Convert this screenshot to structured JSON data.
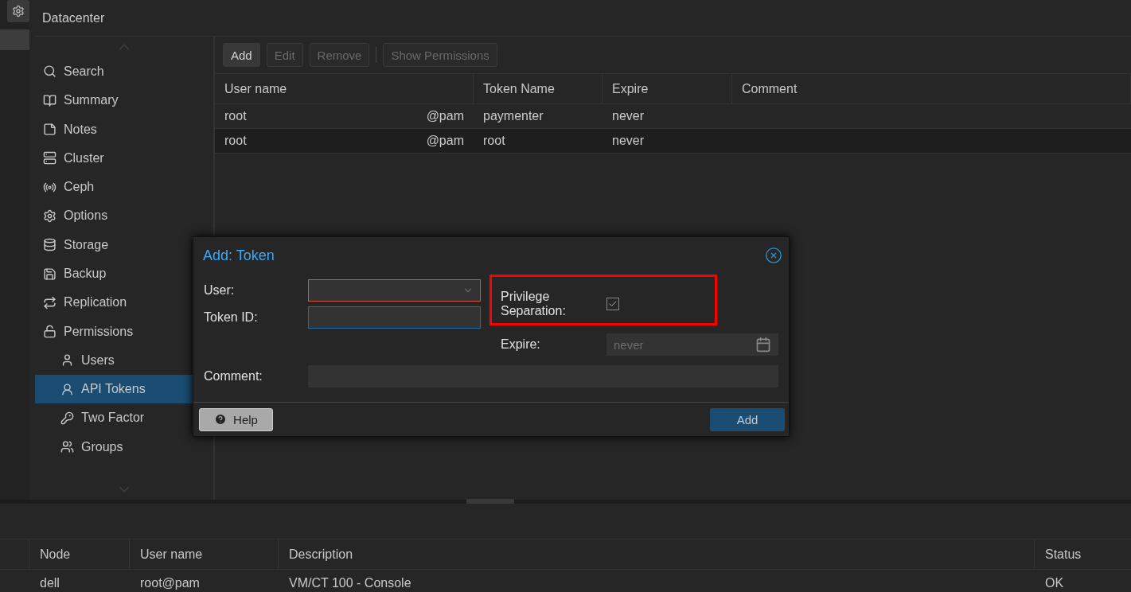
{
  "header": {
    "title": "Datacenter"
  },
  "nav": [
    {
      "label": "Search",
      "selected": false
    },
    {
      "label": "Summary",
      "selected": false
    },
    {
      "label": "Notes",
      "selected": false
    },
    {
      "label": "Cluster",
      "selected": false
    },
    {
      "label": "Ceph",
      "selected": false
    },
    {
      "label": "Options",
      "selected": false
    },
    {
      "label": "Storage",
      "selected": false
    },
    {
      "label": "Backup",
      "selected": false
    },
    {
      "label": "Replication",
      "selected": false
    },
    {
      "label": "Permissions",
      "selected": false,
      "children": [
        {
          "label": "Users",
          "selected": false
        },
        {
          "label": "API Tokens",
          "selected": true
        },
        {
          "label": "Two Factor",
          "selected": false
        },
        {
          "label": "Groups",
          "selected": false
        }
      ]
    }
  ],
  "toolbar": [
    {
      "label": "Add",
      "disabled": false
    },
    {
      "label": "Edit",
      "disabled": true
    },
    {
      "label": "Remove",
      "disabled": true
    },
    {
      "label": "Show Permissions",
      "disabled": true
    }
  ],
  "table": {
    "columns": [
      "User name",
      "Token Name",
      "Expire",
      "Comment"
    ],
    "rows": [
      {
        "user": "root",
        "realm": "@pam",
        "token": "paymenter",
        "expire": "never"
      },
      {
        "user": "root",
        "realm": "@pam",
        "token": "root",
        "expire": "never"
      }
    ]
  },
  "dialog": {
    "title": "Add: Token",
    "user": {
      "label": "User:",
      "invalid": true
    },
    "token_id": {
      "label": "Token ID:",
      "focused": true
    },
    "comment": {
      "label": "Comment:"
    },
    "privilege_separation": {
      "label": "Privilege Separation:",
      "checked": true
    },
    "expire": {
      "label": "Expire:",
      "placeholder": "never"
    },
    "buttons": [
      "Help",
      "Add"
    ]
  },
  "tasks": {
    "columns": [
      "Node",
      "User name",
      "Description",
      "Status"
    ],
    "rows": [
      {
        "node": "dell",
        "user": "root@pam",
        "description": "VM/CT 100 - Console",
        "status": "OK"
      }
    ]
  }
}
